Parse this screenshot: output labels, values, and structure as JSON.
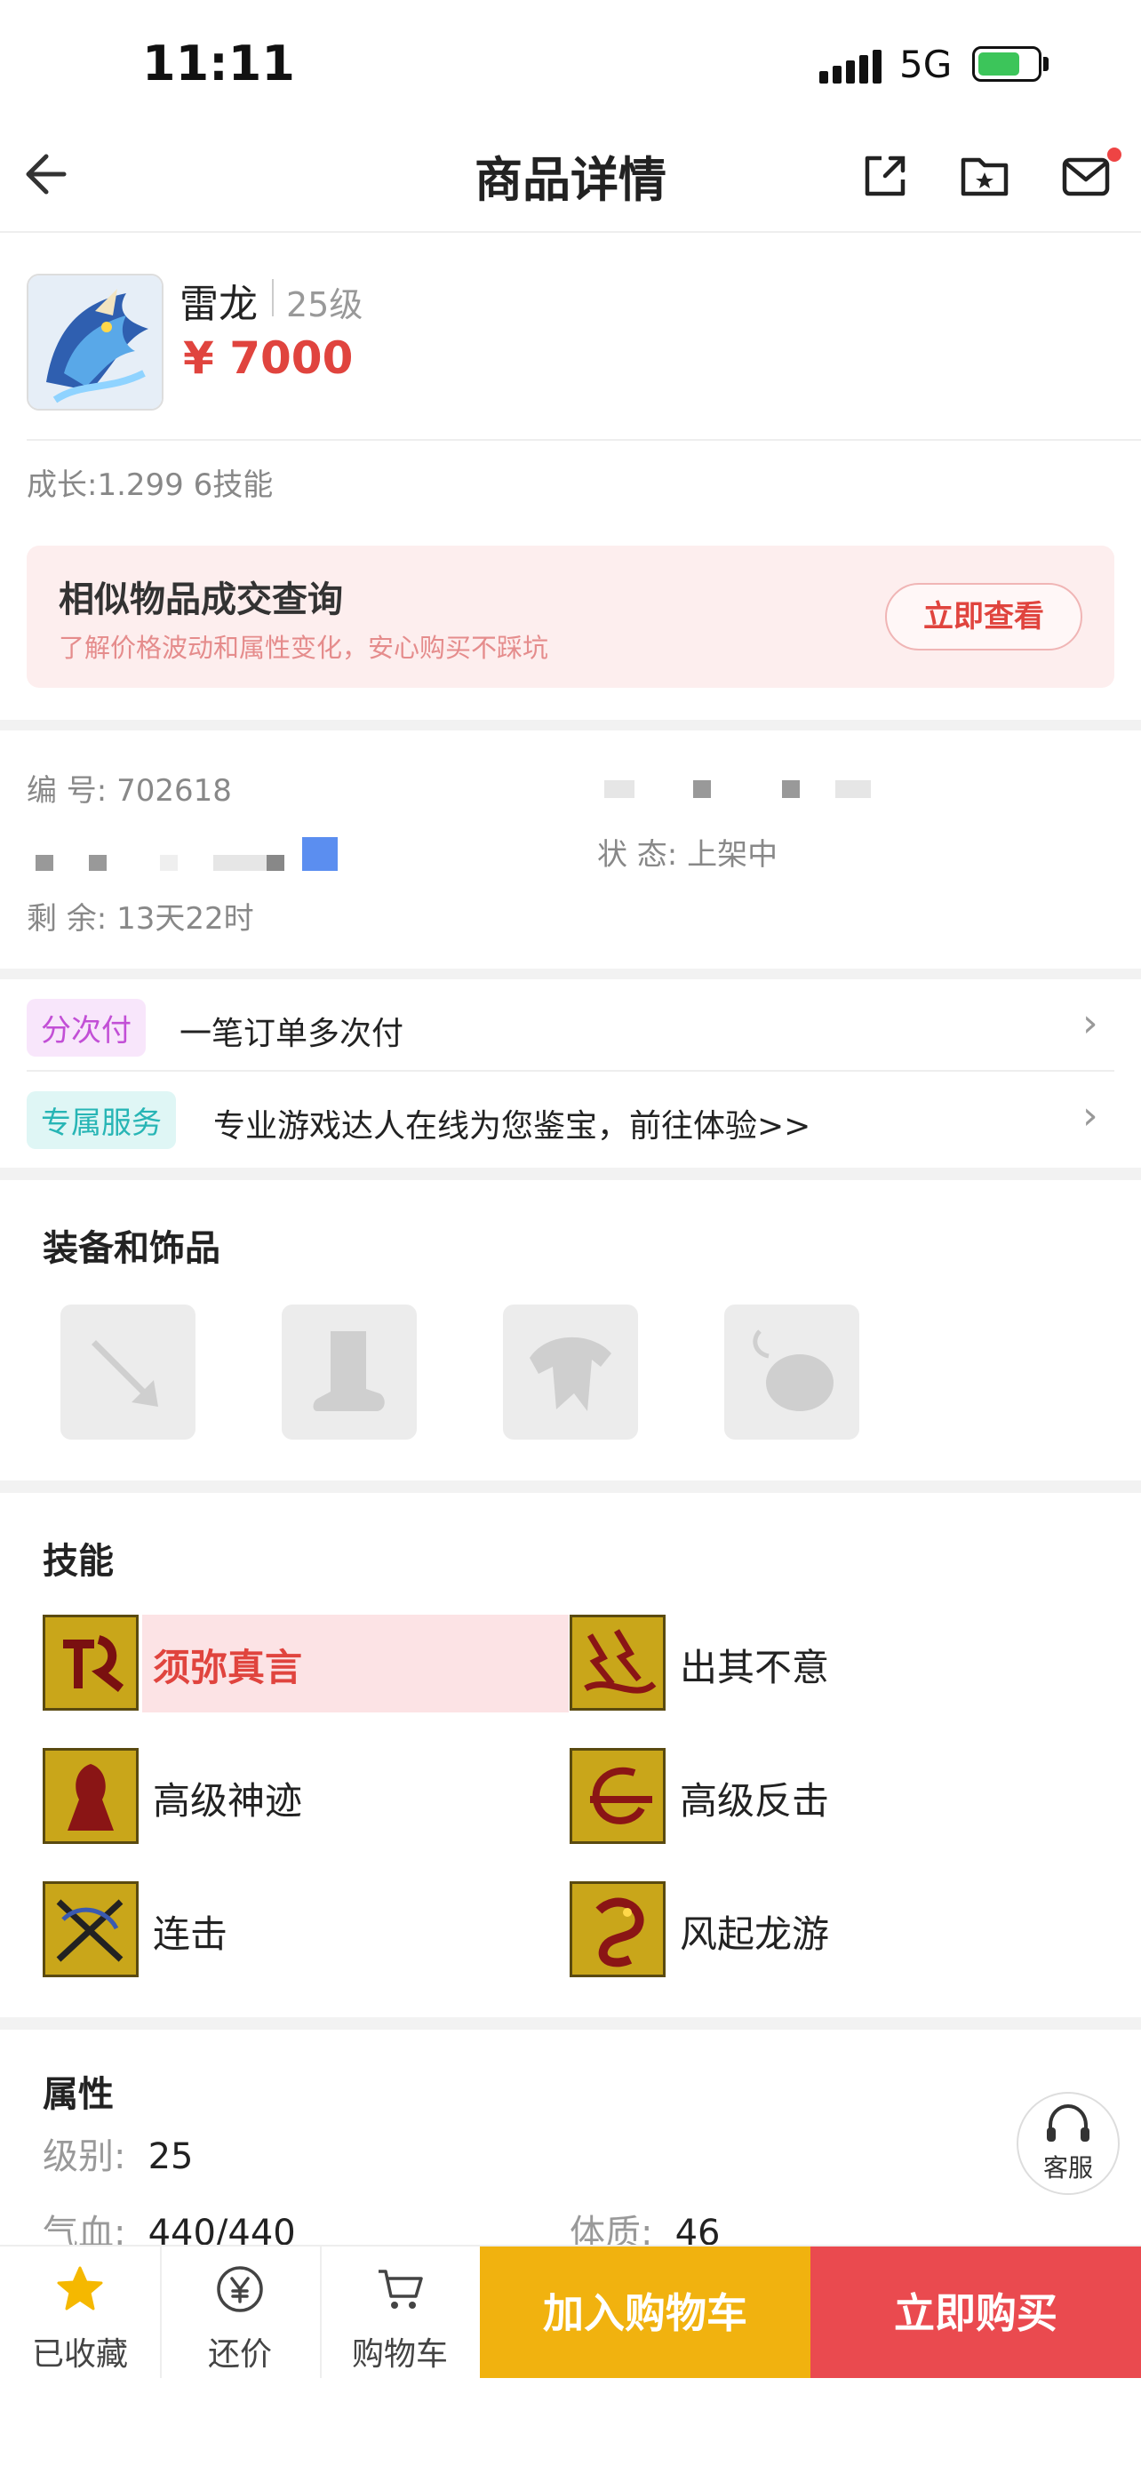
{
  "status_bar": {
    "time": "11:11",
    "network": "5G"
  },
  "nav": {
    "title": "商品详情",
    "icons": [
      "back-arrow-icon",
      "share-icon",
      "favorite-folder-icon",
      "message-icon"
    ]
  },
  "product": {
    "name": "雷龙",
    "level": "25级",
    "price": "¥ 7000",
    "growth": "成长:1.299 6技能"
  },
  "promo": {
    "title": "相似物品成交查询",
    "subtitle": "了解价格波动和属性变化，安心购买不踩坑",
    "button": "立即查看"
  },
  "info": {
    "id_label": "编 号:",
    "id_value": "702618",
    "status_label": "状 态:",
    "status_value": "上架中",
    "remaining_label": "剩 余:",
    "remaining_value": "13天22时"
  },
  "services": [
    {
      "tag": "分次付",
      "text": "一笔订单多次付",
      "tag_color": "#c24fd6",
      "tag_bg": "#f8e6fb"
    },
    {
      "tag": "专属服务",
      "text": "专业游戏达人在线为您鉴宝，前往体验>>",
      "tag_color": "#27b5b5",
      "tag_bg": "#dff6f5"
    }
  ],
  "equipment": {
    "title": "装备和饰品",
    "slots": [
      "weapon-slot-icon",
      "boots-slot-icon",
      "armor-slot-icon",
      "accessory-slot-icon"
    ]
  },
  "skills": {
    "title": "技能",
    "items": [
      {
        "name": "须弥真言",
        "highlighted": true
      },
      {
        "name": "出其不意",
        "highlighted": false
      },
      {
        "name": "高级神迹",
        "highlighted": false
      },
      {
        "name": "高级反击",
        "highlighted": false
      },
      {
        "name": "连击",
        "highlighted": false
      },
      {
        "name": "风起龙游",
        "highlighted": false
      }
    ]
  },
  "attributes": {
    "title": "属性",
    "level_label": "级别:",
    "level_value": "25",
    "hp_label": "气血:",
    "hp_value": "440/440",
    "con_label": "体质:",
    "con_value": "46"
  },
  "customer_service": "客服",
  "bottom_bar": {
    "favorited": "已收藏",
    "bargain": "还价",
    "cart": "购物车",
    "add_cart": "加入购物车",
    "buy_now": "立即购买"
  }
}
